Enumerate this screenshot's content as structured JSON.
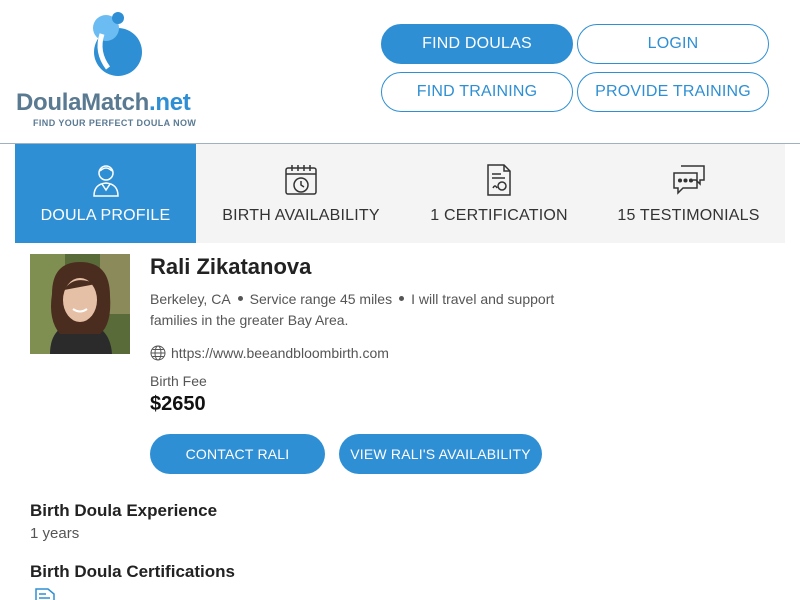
{
  "brand": {
    "name_part1": "Doula",
    "name_part2": "Match",
    "name_part3": ".net",
    "tagline": "FIND YOUR PERFECT DOULA NOW",
    "colors": {
      "primary": "#2e8fd4",
      "secondary": "#5a7a92",
      "light": "#6bbcf2"
    }
  },
  "nav": {
    "find_doulas": "FIND DOULAS",
    "login": "LOGIN",
    "find_training": "FIND TRAINING",
    "provide_training": "PROVIDE TRAINING"
  },
  "tabs": [
    {
      "label": "DOULA PROFILE",
      "icon": "doula-person-icon",
      "active": true
    },
    {
      "label": "BIRTH AVAILABILITY",
      "icon": "calendar-clock-icon",
      "active": false
    },
    {
      "label": "1 CERTIFICATION",
      "icon": "certificate-icon",
      "active": false
    },
    {
      "label": "15 TESTIMONIALS",
      "icon": "chat-bubbles-icon",
      "active": false
    }
  ],
  "profile": {
    "name": "Rali Zikatanova",
    "location": "Berkeley, CA",
    "service_range": "Service range 45 miles",
    "travel_line1": "I will travel and support",
    "travel_line2": "families in the greater Bay Area.",
    "website": "https://www.beeandbloombirth.com",
    "fee_label": "Birth Fee",
    "fee": "$2650",
    "contact_button": "CONTACT RALI",
    "availability_button": "VIEW RALI'S AVAILABILITY"
  },
  "sections": {
    "experience_title": "Birth Doula Experience",
    "experience_value": "1 years",
    "certifications_title": "Birth Doula Certifications"
  }
}
